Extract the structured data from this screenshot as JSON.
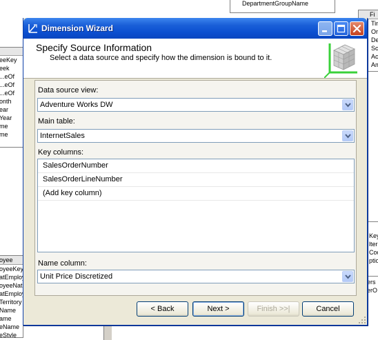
{
  "background": {
    "top_table_row": "DepartmentGroupName",
    "left_table_rows": [
      "eeKey",
      "eek",
      "eOf...",
      "eOf...",
      "eOf...",
      "onth",
      "ear",
      "Year",
      "me",
      "me"
    ],
    "bottom_left_table": {
      "header": "oyee",
      "rows": [
        "oyeeKey",
        "atEmploy",
        "oyeeNat",
        "atEmploy",
        "Territory",
        "Name",
        "ame",
        "eName",
        "eStyle"
      ]
    },
    "right_table_top": {
      "header": "Fi",
      "rows": [
        "Tin",
        "Or",
        "De",
        "Sc",
        "Ac",
        "Am"
      ]
    },
    "right_table_mid": {
      "rows": [
        "Key",
        "lterr",
        "Cod",
        "ptior"
      ]
    },
    "right_table_bottom": {
      "rows": [
        "ers",
        "erO"
      ]
    }
  },
  "wizard": {
    "title": "Dimension Wizard",
    "header_title": "Specify Source Information",
    "header_subtitle": "Select a data source and specify how the dimension is bound to it.",
    "data_source_view_label": "Data source view:",
    "data_source_view_value": "Adventure Works DW",
    "main_table_label": "Main table:",
    "main_table_value": "InternetSales",
    "key_columns_label": "Key columns:",
    "key_columns": [
      "SalesOrderNumber",
      "SalesOrderLineNumber",
      "(Add key column)"
    ],
    "name_column_label": "Name column:",
    "name_column_value": "Unit Price Discretized",
    "buttons": {
      "back": "< Back",
      "next": "Next >",
      "finish": "Finish >>|",
      "cancel": "Cancel"
    },
    "colors": {
      "titlebar": "#0b4fd0",
      "window_bg": "#ece9d8",
      "close_button": "#c6411e"
    }
  }
}
